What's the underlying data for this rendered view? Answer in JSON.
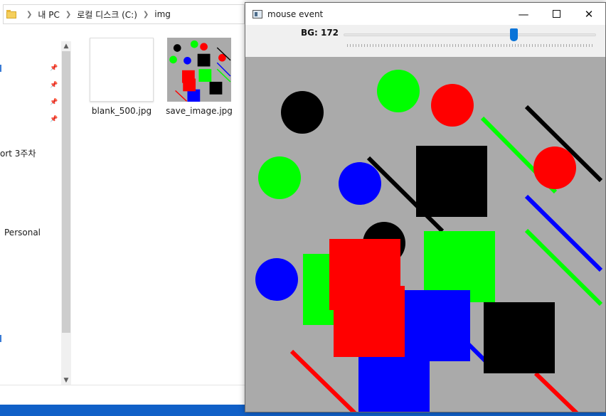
{
  "explorer": {
    "breadcrumb": [
      "내 PC",
      "로컬 디스크 (C:)",
      "img"
    ],
    "nav_items": [
      "ort 3주차",
      "Personal"
    ],
    "files": [
      {
        "name": "blank_500.jpg"
      },
      {
        "name": "save_image.jpg"
      }
    ]
  },
  "cv_window": {
    "title": "mouse event",
    "trackbar": {
      "label": "BG: 172",
      "value": 172,
      "max": 255
    },
    "canvas_bg": "#aaaaaa",
    "controls": {
      "minimize": "—",
      "close": "✕"
    }
  },
  "colors": {
    "red": "#ff0000",
    "green": "#00ff00",
    "blue": "#0000ff",
    "black": "#000000",
    "taskbar": "#1060c8",
    "accent": "#0a74d8"
  }
}
